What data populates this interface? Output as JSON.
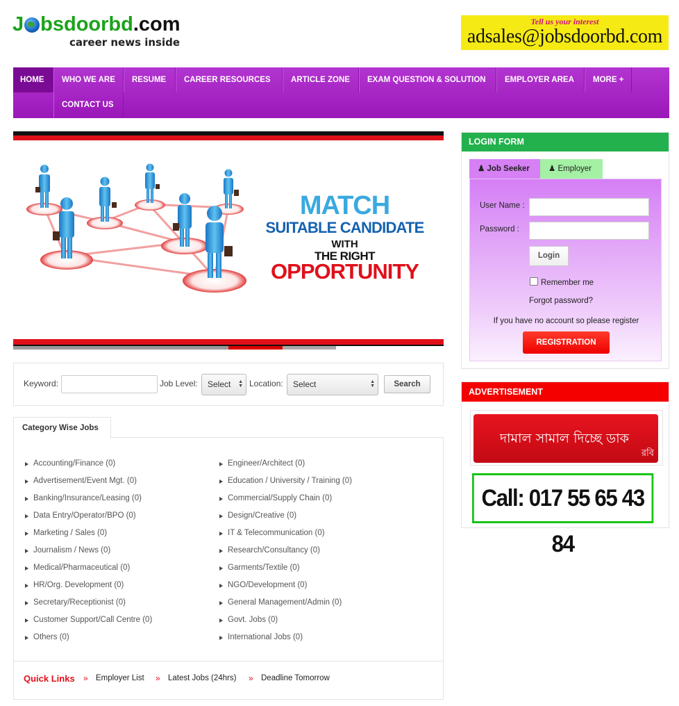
{
  "header": {
    "logo_parts": [
      "J",
      "bsdoorbd",
      ".com"
    ],
    "logo_tagline": "career news inside",
    "top_ad_small": "Tell us your interest",
    "top_ad_email": "adsales@jobsdoorbd.com"
  },
  "nav": {
    "items": [
      "HOME",
      "WHO WE ARE",
      "RESUME",
      "CAREER RESOURCES",
      "ARTICLE ZONE",
      "EXAM QUESTION & SOLUTION",
      "EMPLOYER AREA",
      "MORE +",
      "CONTACT US"
    ]
  },
  "slider": {
    "line1": "MATCH",
    "line2": "SUITABLE CANDIDATE",
    "line3": "WITH",
    "line4": "THE RIGHT",
    "line5": "OPPORTUNITY"
  },
  "search": {
    "keyword_label": "Keyword:",
    "keyword_value": "",
    "job_level_label": "Job Level:",
    "job_level_value": "Select",
    "location_label": "Location:",
    "location_value": "Select",
    "button": "Search"
  },
  "categories": {
    "tab_label": "Category Wise Jobs",
    "left": [
      "Accounting/Finance (0)",
      "Advertisement/Event Mgt. (0)",
      "Banking/Insurance/Leasing (0)",
      "Data Entry/Operator/BPO (0)",
      "Marketing / Sales (0)",
      "Journalism / News (0)",
      "Medical/Pharmaceutical (0)",
      "HR/Org. Development (0)",
      "Secretary/Receptionist (0)",
      "Customer Support/Call Centre (0)",
      "Others (0)"
    ],
    "right": [
      "Engineer/Architect (0)",
      "Education / University / Training (0)",
      "Commercial/Supply Chain (0)",
      "Design/Creative (0)",
      "IT & Telecommunication (0)",
      "Research/Consultancy (0)",
      "Garments/Textile (0)",
      "NGO/Development (0)",
      "General Management/Admin (0)",
      "Govt. Jobs (0)",
      "International Jobs (0)"
    ]
  },
  "quick_links": {
    "title": "Quick Links",
    "separator": "»",
    "links": [
      "Employer List",
      "Latest Jobs (24hrs)",
      "Deadline Tomorrow"
    ]
  },
  "login": {
    "header": "LOGIN FORM",
    "tab_jobseeker": "Job Seeker",
    "tab_employer": "Employer",
    "username_label": "User Name :",
    "password_label": "Password :",
    "login_button": "Login",
    "remember": "Remember me",
    "forgot": "Forgot password?",
    "register_note": "If you have no account so please register",
    "register_button": "REGISTRATION"
  },
  "ads": {
    "header": "ADVERTISEMENT",
    "robi_text": "দামাল সামাল দিচ্ছে ডাক",
    "robi_brand": "রবি",
    "call_text": "Call: 017 55 65 43 84"
  },
  "colors": {
    "nav_purple": "#a020c0",
    "login_green": "#22b14c",
    "ad_red": "#f40000",
    "accent_red": "#e0101a"
  }
}
